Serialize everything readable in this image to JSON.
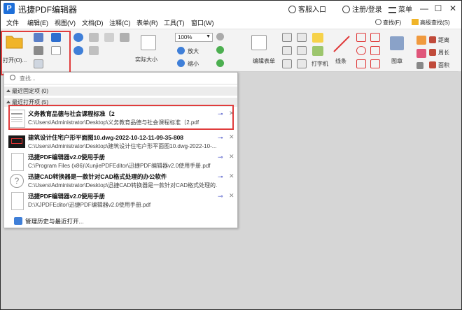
{
  "app": {
    "title": "迅捷PDF编辑器",
    "logo": "P",
    "header_links": [
      "客服入口",
      "注册/登录",
      "菜单"
    ],
    "window_controls": [
      "—",
      "☐",
      "✕"
    ]
  },
  "menubar": [
    "文件",
    "编辑(E)",
    "视图(V)",
    "文档(D)",
    "注释(C)",
    "表单(R)",
    "工具(T)",
    "窗口(W)"
  ],
  "ribbon": {
    "open_label": "打开(O)...",
    "zoom_value": "100%",
    "actual_size": "实际大小",
    "zoom_in": "放大",
    "zoom_out": "缩小",
    "edit_form": "编辑表单",
    "typewriter": "打字机",
    "line": "线条",
    "stamp": "图章",
    "find": "查找(F)",
    "advanced_find": "高级查找(S)",
    "distance": "距离",
    "perimeter": "周长",
    "area": "面积"
  },
  "dropdown": {
    "search_placeholder": "查找...",
    "pinned_header": "最近固定项 (0)",
    "recent_header": "最近打开项 (5)",
    "recent": [
      {
        "title": "义务教育品德与社会课程标准〔2",
        "path": "C:\\Users\\Administrator\\Desktop\\义务教育品德与社会课程标准〔2.pdf",
        "thumb": "doc"
      },
      {
        "title": "建筑设计住宅户形平面图10.dwg-2022-10-12-11-09-35-808",
        "path": "C:\\Users\\Administrator\\Desktop\\建筑设计住宅户形平面图10.dwg-2022-10-...",
        "thumb": "dark"
      },
      {
        "title": "迅捷PDF编辑器v2.0使用手册",
        "path": "C:\\Program Files (x86)\\XunjiePDFEditor\\迅捷PDF编辑器v2.0使用手册.pdf",
        "thumb": "blank"
      },
      {
        "title": "迅捷CAD转换器是一款针对CAD格式处理的办公软件",
        "path": "C:\\Users\\Administrator\\Desktop\\迅捷CAD转换器是一款针对CAD格式处理的...",
        "thumb": "question"
      },
      {
        "title": "迅捷PDF编辑器v2.0使用手册",
        "path": "D:\\XJPDFEditor\\迅捷PDF编辑器v2.0使用手册.pdf",
        "thumb": "blank"
      }
    ],
    "footer": "管理历史与最近打开..."
  },
  "colors": {
    "accent": "#1e6fd9",
    "highlight": "#e03c3c",
    "pin": "#4a55c8",
    "folder": "#f0b429"
  }
}
